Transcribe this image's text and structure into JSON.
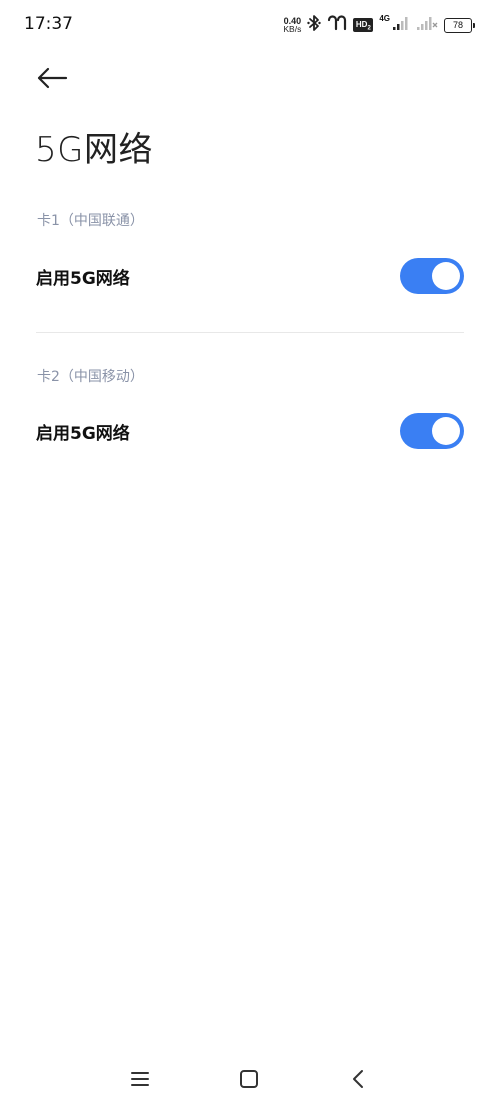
{
  "status_bar": {
    "time": "17:37",
    "net_speed_value": "0.40",
    "net_speed_unit": "KB/s",
    "hd_label": "HD",
    "hd_sub": "2",
    "network_type": "4G",
    "battery_level": "78",
    "icons": [
      "bluetooth-icon",
      "earbuds-icon",
      "hd-voice-icon",
      "signal-sim1-icon",
      "signal-sim2-icon",
      "battery-icon"
    ]
  },
  "header": {
    "back_icon": "arrow-left-icon",
    "title": "5G网络"
  },
  "sections": [
    {
      "header": "卡1（中国联通）",
      "row_label": "启用5G网络",
      "enabled": true
    },
    {
      "header": "卡2（中国移动）",
      "row_label": "启用5G网络",
      "enabled": true
    }
  ],
  "colors": {
    "accent": "#3a7ff3",
    "section_header": "#8a93a8",
    "divider": "#e8e8e8"
  },
  "nav_bar": {
    "icons": [
      "menu-icon",
      "home-icon",
      "back-icon"
    ]
  }
}
